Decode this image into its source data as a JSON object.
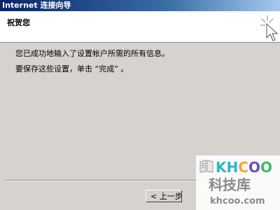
{
  "window": {
    "title": "Internet 连接向导"
  },
  "header": {
    "title": "祝贺您",
    "icon": "wizard-cursor-icon"
  },
  "content": {
    "line1": "您已成功地输入了设置帐户所需的所有信息。",
    "line2": "要保存这些设置，单击 “完成” 。"
  },
  "buttons": {
    "back_label": "< 上一步"
  },
  "watermark": {
    "brand": "KHCOO",
    "name": "科技库",
    "domain": "khcoo.com"
  },
  "colors": {
    "title_bar": "#0a246a",
    "window_bg": "#d6d3ce",
    "header_bg": "#ffffff"
  }
}
